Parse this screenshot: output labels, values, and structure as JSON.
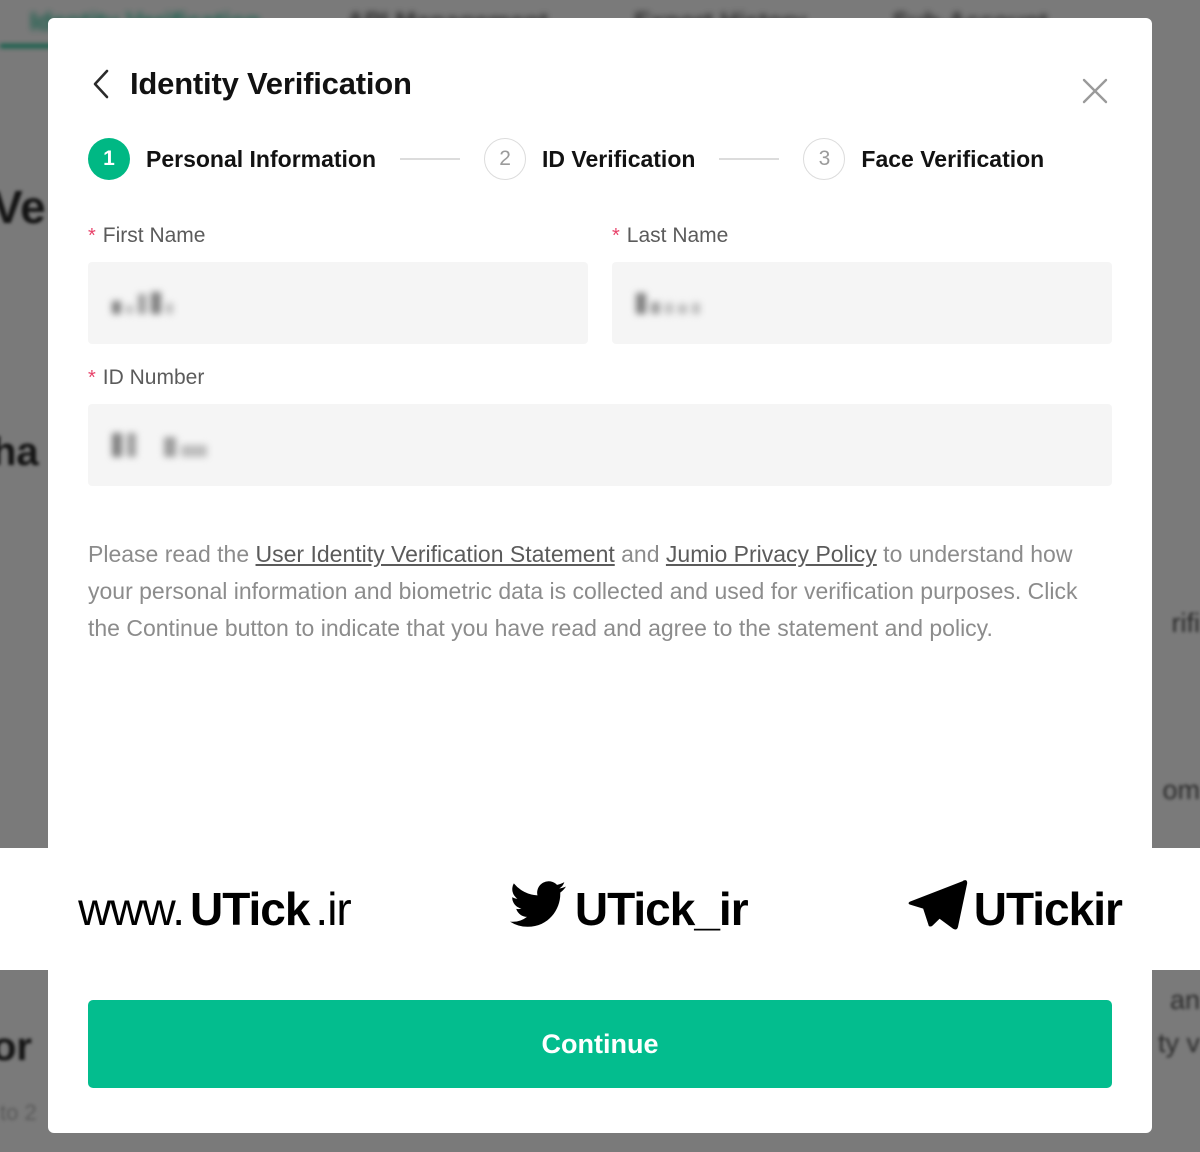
{
  "background": {
    "tabs": [
      "Identity Verification",
      "API Management",
      "Export History",
      "Sub-Account"
    ],
    "fragments": {
      "heading_left": "Ve",
      "mid_left": "ha",
      "lower_left": "or",
      "footnote_left": "to 2",
      "right_verify": "rifi",
      "right_om": "om",
      "right_and": "an",
      "right_tyv": "ty v"
    }
  },
  "modal": {
    "title": "Identity Verification",
    "back_icon": "chevron-left-icon",
    "close_icon": "close-icon",
    "stepper": [
      {
        "number": "1",
        "label": "Personal Information",
        "state": "done"
      },
      {
        "number": "2",
        "label": "ID Verification",
        "state": "todo"
      },
      {
        "number": "3",
        "label": "Face Verification",
        "state": "todo"
      }
    ],
    "fields": {
      "first_name": {
        "label": "First Name",
        "required_marker": "*",
        "value": "",
        "placeholder": ""
      },
      "last_name": {
        "label": "Last Name",
        "required_marker": "*",
        "value": "",
        "placeholder": ""
      },
      "id_number": {
        "label": "ID Number",
        "required_marker": "*",
        "value": "",
        "placeholder": ""
      }
    },
    "disclaimer": {
      "part1": "Please read the ",
      "link1": "User Identity Verification Statement",
      "part2": " and ",
      "link2": "Jumio Privacy Policy",
      "part3": " to understand how your personal information and biometric data is collected and used for verification purposes. Click the Continue button to indicate that you have read and agree to the statement and policy."
    },
    "continue_label": "Continue"
  },
  "watermark": {
    "site": {
      "prefix": "www.",
      "brand": "UTick",
      "suffix": ".ir"
    },
    "twitter": {
      "icon": "twitter-bird-icon",
      "handle": "UTick_ir"
    },
    "telegram": {
      "icon": "telegram-plane-icon",
      "handle": "UTickir"
    }
  },
  "colors": {
    "accent_green": "#03bd8e",
    "step_done": "#00b884",
    "required_star": "#e8426a",
    "input_bg": "#f5f5f5",
    "backdrop": "#7a7a7a"
  }
}
